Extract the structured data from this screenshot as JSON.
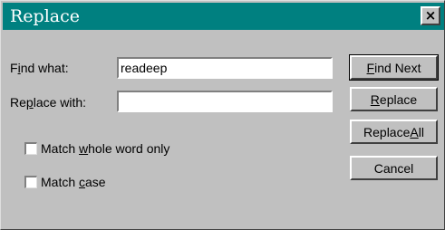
{
  "window": {
    "title": "Replace",
    "close_glyph": "×",
    "titlebar_color": "#008080",
    "face_color": "#c0c0c0"
  },
  "fields": {
    "find_what": {
      "label_pre": "F",
      "label_access": "i",
      "label_post": "nd what:",
      "value": "readeep"
    },
    "replace_with": {
      "label_pre": "Re",
      "label_access": "p",
      "label_post": "lace with:",
      "value": ""
    }
  },
  "options": {
    "whole_word": {
      "label_pre": "Match ",
      "label_access": "w",
      "label_post": "hole word only",
      "checked": false
    },
    "match_case": {
      "label_pre": "Match ",
      "label_access": "c",
      "label_post": "ase",
      "checked": false
    }
  },
  "buttons": {
    "find_next": {
      "pre": "",
      "access": "F",
      "post": "ind Next"
    },
    "replace": {
      "pre": "",
      "access": "R",
      "post": "eplace"
    },
    "replace_all": {
      "pre": "Replace ",
      "access": "A",
      "post": "ll"
    },
    "cancel": {
      "pre": "Cancel",
      "access": "",
      "post": ""
    }
  }
}
